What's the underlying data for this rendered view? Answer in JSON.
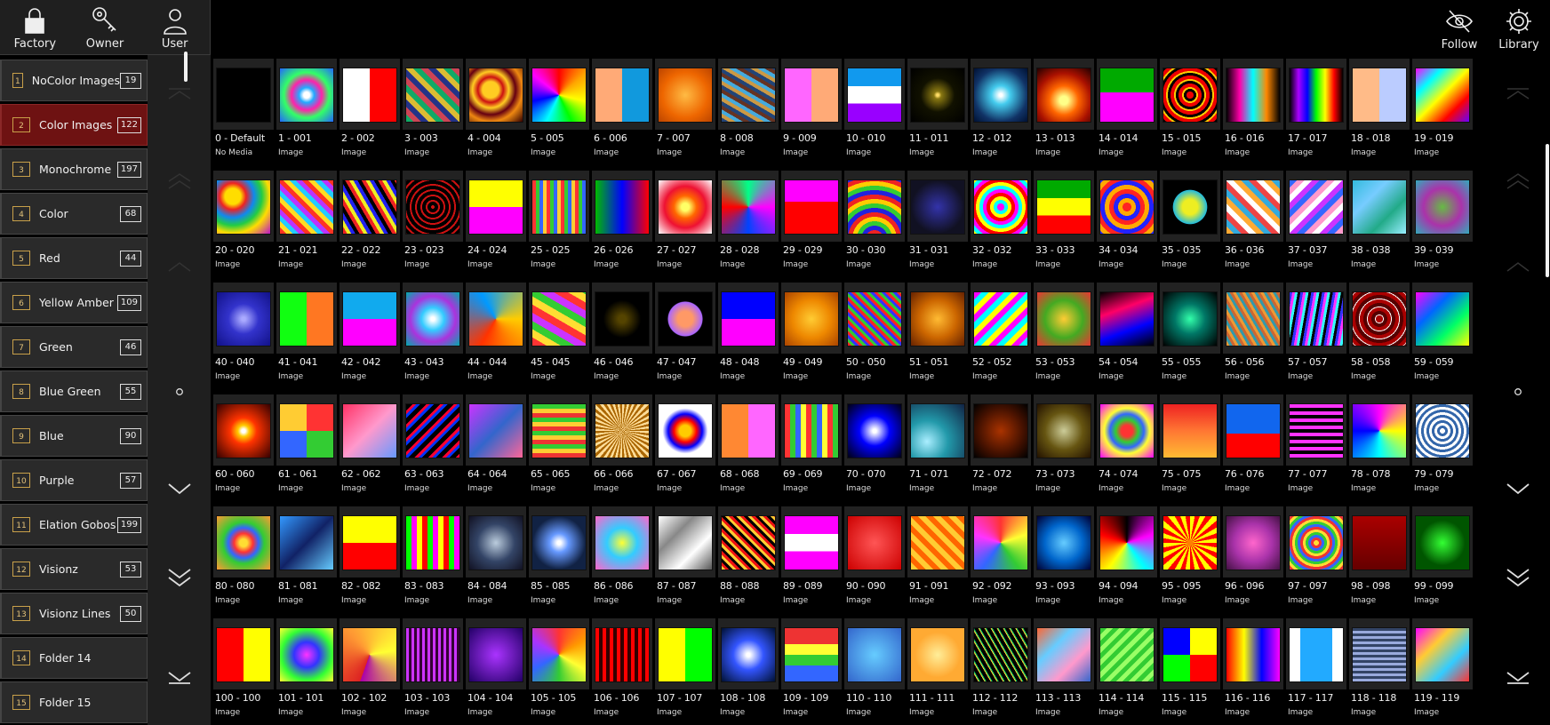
{
  "roles": [
    {
      "label": "Factory",
      "icon": "lock-icon"
    },
    {
      "label": "Owner",
      "icon": "key-icon"
    },
    {
      "label": "User",
      "icon": "user-icon"
    }
  ],
  "toolbar": [
    {
      "label": "Follow",
      "icon": "eye-slash-icon"
    },
    {
      "label": "Library",
      "icon": "gear-icon"
    }
  ],
  "folders": [
    {
      "num": "1",
      "name": "NoColor Images",
      "count": "19",
      "active": false
    },
    {
      "num": "2",
      "name": "Color Images",
      "count": "122",
      "active": true
    },
    {
      "num": "3",
      "name": "Monochrome",
      "count": "197",
      "active": false
    },
    {
      "num": "4",
      "name": "Color",
      "count": "68",
      "active": false
    },
    {
      "num": "5",
      "name": "Red",
      "count": "44",
      "active": false
    },
    {
      "num": "6",
      "name": "Yellow Amber",
      "count": "109",
      "active": false
    },
    {
      "num": "7",
      "name": "Green",
      "count": "46",
      "active": false
    },
    {
      "num": "8",
      "name": "Blue Green",
      "count": "55",
      "active": false
    },
    {
      "num": "9",
      "name": "Blue",
      "count": "90",
      "active": false
    },
    {
      "num": "10",
      "name": "Purple",
      "count": "57",
      "active": false
    },
    {
      "num": "11",
      "name": "Elation Gobos",
      "count": "199",
      "active": false
    },
    {
      "num": "12",
      "name": "Visionz",
      "count": "53",
      "active": false
    },
    {
      "num": "13",
      "name": "Visionz Lines",
      "count": "50",
      "active": false
    },
    {
      "num": "14",
      "name": "Folder 14",
      "count": "",
      "active": false
    },
    {
      "num": "15",
      "name": "Folder 15",
      "count": "",
      "active": false
    }
  ],
  "media": {
    "default_label": "0 - Default",
    "default_sub": "No Media",
    "item_sub": "Image",
    "count": 120,
    "thumbs": [
      "#000000",
      "radial-gradient(circle,#fff 0 8%,#2af 20%,#f2a 40%,#3f6 60%,#26f 100%)",
      "linear-gradient(90deg,#fff 0 50%,#f00 50%)",
      "repeating-linear-gradient(45deg,#1a6 0 6px,#c45 6px 12px,#238 12px 18px,#db3 18px 24px)",
      "radial-gradient(circle at 40% 40%,#fc2 0 18%,#c11 28%,#fc2 40%,#601 55%,#e81 70%,#300 100%)",
      "conic-gradient(red,orange,yellow,lime,cyan,blue,magenta,red)",
      "linear-gradient(90deg,#fa7 0 50%,#19d 50%)",
      "radial-gradient(circle,#fb4,#e60 60%,#b40)",
      "repeating-linear-gradient(30deg,#247 0 4px,#c94 4px 8px,#4ad 8px 12px,#632 12px 16px)",
      "linear-gradient(90deg,#f6f 0 50%,#fa7 50%)",
      "linear-gradient(#19e 0 33%,#fff 33% 66%,#90f 66%)",
      "radial-gradient(circle at 50% 50%,#fd6 0 3%,#871 10%,#110 45%,#000)",
      "radial-gradient(circle,#fff 0 4%,#4ce 25%,#136 70%,#013)",
      "radial-gradient(circle at 50% 60%,#ff8 0 10%,#f60 35%,#a10 65%,#200)",
      "linear-gradient(#0a0 0 45%,#f0f 45%)",
      "repeating-radial-gradient(circle,#e00 0 4px,#000 4px 7px,#fc0 7px 9px)",
      "linear-gradient(90deg,#000,#f0a,#0ff,#f80,#000)",
      "linear-gradient(90deg,#000,#a0f,#00f,#0f0,#ff0,#f00,#000)",
      "linear-gradient(90deg,#fb8 0 50%,#bcf 50%)",
      "linear-gradient(135deg,#f0f,#0ff,#ff0,#f00,#60f)",
      "radial-gradient(circle at 30% 30%,#fd0 0 15%,#e22 25%,#18e 40%,#2c4 55%,#fd0 70%,#b1c 100%)",
      "repeating-linear-gradient(45deg,#f32 0 5px,#fd2 5px 10px,#2cf 10px 15px,#b3f 15px 20px)",
      "repeating-linear-gradient(60deg,#e22 0 4px,#ee2 4px 8px,#22e 8px 12px,#000 12px 16px)",
      "repeating-radial-gradient(circle,#c11 0 2px,#000 2px 6px)",
      "linear-gradient(#ff0 0 50%,#f0f 50%)",
      "repeating-linear-gradient(90deg,#f33 0 4px,#3c3 4px 8px,#36f 8px 12px,#fc3 12px 16px)",
      "linear-gradient(90deg,#0b0,#00f 50%,#f00)",
      "radial-gradient(circle,#ff6 0 10%,#f60 30%,#e13 55%,#fff 100%)",
      "conic-gradient(#0f8,#f0f,#04f,#f00,#0f8)",
      "linear-gradient(#f0f 0 40%,#f00 40%)",
      "repeating-radial-gradient(circle at 50% 110%,#fc0 0 5px,#e22 5px 10px,#22d 10px 15px,#3c3 15px 20px)",
      "radial-gradient(circle,#33a,#112 70%)",
      "repeating-radial-gradient(circle,#f0f 0 4px,#0ff 4px 8px,#ff0 8px 12px,#f00 12px 16px)",
      "linear-gradient(#0a0 0 33%,#ff0 33% 66%,#f00 66%)",
      "repeating-radial-gradient(circle,#f22 0 5px,#fa0 5px 10px,#22f 10px 15px)",
      "radial-gradient(circle,#ee2 0 20%,#2bd 45%,#000 46%)",
      "repeating-linear-gradient(45deg,#fa3 0 6px,#3ad 6px 12px,#e44 12px 18px,#fff 18px 24px)",
      "repeating-linear-gradient(135deg,#36f 0 6px,#f9c 6px 12px,#fff 12px 18px,#c3f 18px 24px)",
      "linear-gradient(135deg,#3bd,#7cf,#2a8,#9ef)",
      "radial-gradient(circle,#6b4,#a3a,#3ab)",
      "radial-gradient(circle,#aaf 0 5%,#33c 40%,#118)",
      "linear-gradient(90deg,#1f1 0 50%,#f72 50%)",
      "linear-gradient(#1ae 0 50%,#f0f 50%)",
      "radial-gradient(circle,#fff 0 5%,#3cf 30%,#a3d 60%,#0aa)",
      "conic-gradient(from 90deg,#fc0,#f30,#09f,#fc0)",
      "repeating-linear-gradient(30deg,#f33 0 8px,#fd3 8px 16px,#3c3 16px 24px,#c3f 24px 32px)",
      "radial-gradient(circle,#540 0 10%,#000 50%)",
      "radial-gradient(circle,#f96 0 20%,#a6f 45%,#000 47%)",
      "linear-gradient(#00f 0 50%,#f0f 50%)",
      "radial-gradient(circle,#fc3,#e80,#a40)",
      "repeating-linear-gradient(45deg,#f22 0 3px,#3c3 3px 6px,#33f 6px 9px)",
      "radial-gradient(circle,#fb3,#c60,#620)",
      "repeating-linear-gradient(135deg,#f0f 0 6px,#0ff 6px 12px,#ff0 12px 18px)",
      "radial-gradient(circle,#fc3,#4a2,#e33)",
      "linear-gradient(160deg,#000,#f06,#00f,#000)",
      "radial-gradient(circle,#3fa,#076 40%,#000)",
      "repeating-linear-gradient(60deg,#e93 0 3px,#39a 3px 6px,#c63 6px 9px)",
      "repeating-linear-gradient(100deg,#33f 0 3px,#f3f 3px 6px,#3ff 6px 9px,#000 9px 12px)",
      "repeating-radial-gradient(circle,#a00 0 4px,#fff 4px 5px,#500 5px 9px)",
      "linear-gradient(135deg,#f0f,#06f,#0f6,#ff0)",
      "radial-gradient(circle,#fff 0 5%,#fc0 15%,#f30 35%,#300)",
      "conic-gradient(#f33 0 25%,#3c3 0 50%,#36f 0 75%,#fc3 0)",
      "linear-gradient(135deg,#f36,#f9c 50%,#69f)",
      "repeating-linear-gradient(135deg,#000 0 5px,#f03 5px 8px,#03f 8px 11px)",
      "linear-gradient(135deg,#c3f,#36c,#f69)",
      "repeating-linear-gradient(0deg,#e33 0 5px,#fc3 5px 10px,#3c3 10px 15px)",
      "repeating-conic-gradient(#fd9 0 5deg,#a60 5deg 10deg)",
      "radial-gradient(circle,#fc0 0 15%,#f00 30%,#00f 45%,#fff 60%)",
      "linear-gradient(90deg,#f83 0 50%,#f6f 50%)",
      "repeating-linear-gradient(90deg,#f33 0 6px,#3c3 6px 12px,#36f 12px 18px,#ff3 18px 24px)",
      "radial-gradient(circle,#fff 0 5%,#00f 40%,#001)",
      "radial-gradient(circle at 30% 70%,#aef,#29a 40%,#124)",
      "radial-gradient(circle,#a30,#410 60%,#000)",
      "radial-gradient(circle,#cc9,#651 50%,#210)",
      "radial-gradient(circle,#f33 0 15%,#3c3 30%,#36f 45%,#ff3 60%,#f0f 100%)",
      "linear-gradient(#e22,#f73,#fb3)",
      "linear-gradient(#16e 0 55%,#f00 55%)",
      "repeating-linear-gradient(0deg,#f3f 0 4px,#000 4px 8px)",
      "conic-gradient(#f0f,#ff0,#0ff,#00f,#f0f)",
      "repeating-radial-gradient(circle,#fff 0 3px,#36a 3px 6px)",
      "radial-gradient(circle,#fd3 0 10%,#f33 25%,#36f 40%,#3c3 55%,#f93 100%)",
      "linear-gradient(135deg,#39f,#126,#6cf)",
      "linear-gradient(#ff0 0 50%,#f00 50%)",
      "repeating-linear-gradient(90deg,#0f0 0 6px,#f0f 6px 12px,#ff0 12px 18px,#f00 18px 24px)",
      "radial-gradient(circle,#bcd,#346,#112)",
      "radial-gradient(circle,#fff 0 5%,#69f 25%,#124 70%)",
      "radial-gradient(circle,#ff3,#3cf 40%,#f6c)",
      "linear-gradient(135deg,#fff,#888,#fff,#555)",
      "repeating-linear-gradient(45deg,#fc3 0 3px,#e11 3px 6px,#000 6px 9px)",
      "linear-gradient(#f0f 0 33%,#fff 33% 66%,#f0f 66%)",
      "radial-gradient(circle,#f55,#c00)",
      "repeating-linear-gradient(45deg,#fc3 0 6px,#f60 6px 12px)",
      "conic-gradient(#f33,#ff3,#3c3,#36f,#f3f,#f33)",
      "radial-gradient(circle,#6cf,#06c,#003)",
      "conic-gradient(#000,#f0f,#0ff,#ff0,#f00,#000)",
      "repeating-conic-gradient(#ff0 0 10deg,#f00 10deg 20deg)",
      "radial-gradient(circle,#f6c,#a3a,#414)",
      "repeating-radial-gradient(circle,#fd3 0 3px,#e33 3px 6px,#36f 6px 9px,#3c3 9px 12px)",
      "linear-gradient(#a00,#600)",
      "radial-gradient(circle,#3f3,#050 60%)",
      "linear-gradient(90deg,#f00 0 50%,#ff0 50%)",
      "radial-gradient(circle,#f3f,#33f,#3f3,#ff3)",
      "conic-gradient(from 200deg,#d22,#f93,#ff3,#a0a)",
      "repeating-linear-gradient(90deg,#c3f 0 3px,#303 3px 6px)",
      "radial-gradient(circle,#a3f,#206)",
      "conic-gradient(#f33,#f90,#ff3,#3c3,#36f,#a3f,#f33)",
      "repeating-linear-gradient(90deg,#f00 0 4px,#300 4px 8px)",
      "linear-gradient(90deg,#ff0 0 50%,#0f0 50%)",
      "radial-gradient(circle,#fff 0 5%,#35f 40%,#013)",
      "linear-gradient(#e33 0 30%,#ff3 30% 50%,#3c3 50% 70%,#36f 70%)",
      "radial-gradient(circle,#6cf,#36c)",
      "radial-gradient(circle,#fe9,#fa3 60%)",
      "repeating-linear-gradient(60deg,#000 0 4px,#fc3 4px 5px,#0c6 5px 6px)",
      "linear-gradient(135deg,#f63,#6cf,#f9c,#36c)",
      "repeating-linear-gradient(135deg,#3c3 0 5px,#9f6 5px 10px)",
      "conic-gradient(#ff0 0 25%,#f00 0 50%,#0f0 0 75%,#00f 0)",
      "linear-gradient(90deg,#f00,#ff0 33%,#00f 66%,#f0f)",
      "linear-gradient(90deg,#fff 0 20%,#2af 20% 80%,#fff 80%)",
      "repeating-linear-gradient(0deg,#9ad 0 3px,#346 3px 6px)",
      "linear-gradient(135deg,#f0f,#fc3,#3cf,#f33)"
    ]
  }
}
